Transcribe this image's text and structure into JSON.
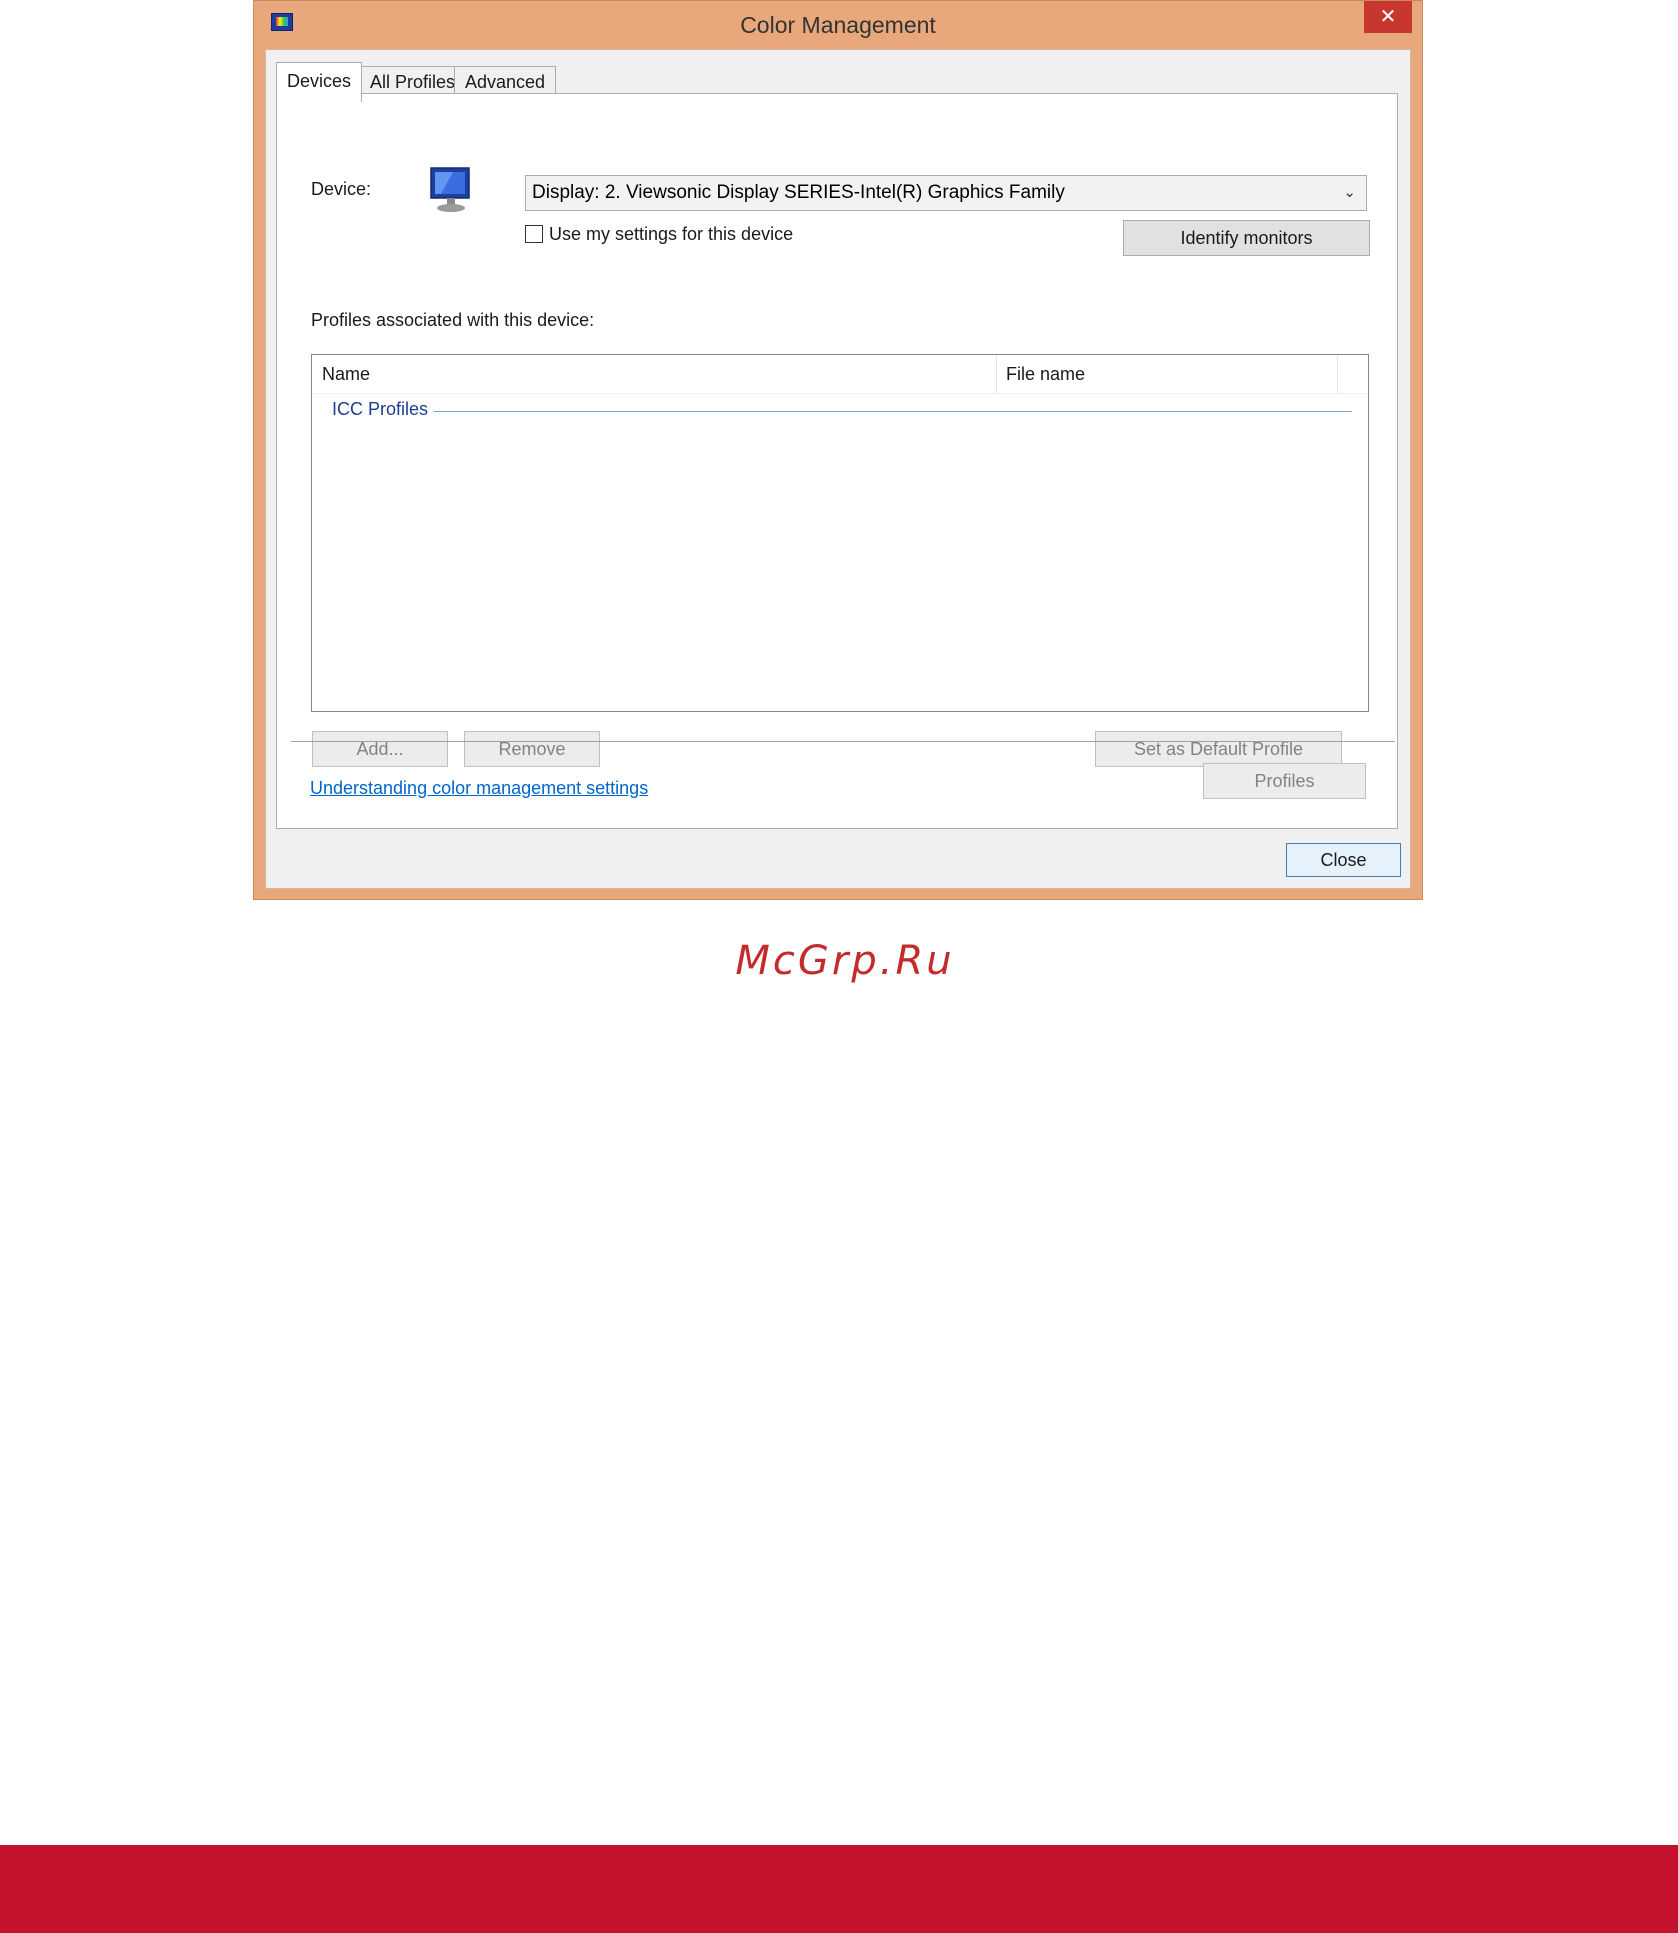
{
  "window": {
    "title": "Color Management",
    "close_glyph": "✕",
    "icon": "color-management-icon"
  },
  "tabs": [
    {
      "label": "Devices",
      "active": true
    },
    {
      "label": "All Profiles",
      "active": false
    },
    {
      "label": "Advanced",
      "active": false
    }
  ],
  "devices": {
    "device_label": "Device:",
    "device_icon": "monitor-icon",
    "device_selected": "Display: 2. Viewsonic Display SERIES-Intel(R) Graphics Family",
    "dropdown_glyph": "⌄",
    "use_my_settings_label": "Use my settings for this device",
    "use_my_settings_checked": false,
    "identify_monitors_label": "Identify monitors",
    "profiles_heading": "Profiles associated with this device:",
    "columns": [
      "Name",
      "File name"
    ],
    "group_label": "ICC Profiles",
    "add_label": "Add...",
    "remove_label": "Remove",
    "set_default_label": "Set as Default Profile",
    "help_link": "Understanding color management settings",
    "profiles_button_label": "Profiles"
  },
  "footer": {
    "close_label": "Close"
  },
  "watermark": "McGrp.Ru",
  "colors": {
    "frame": "#e8a87c",
    "close": "#c7372f",
    "link": "#0066cc",
    "group": "#1e3d8f",
    "brand_band": "#c4112e",
    "watermark": "#c42b2b"
  }
}
